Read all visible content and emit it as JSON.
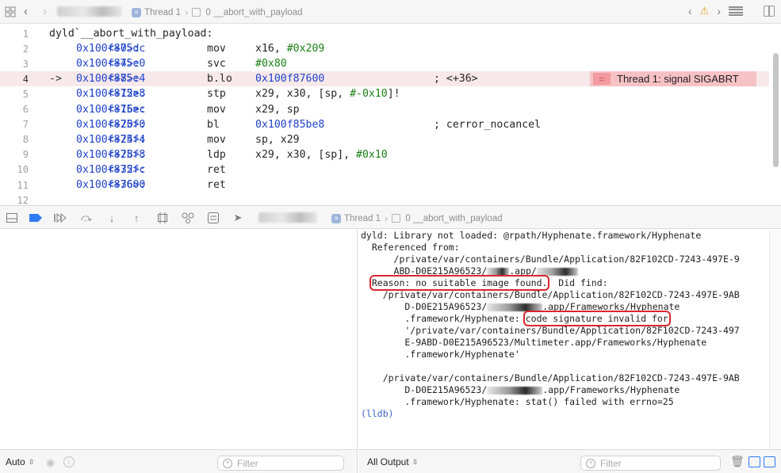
{
  "jump_bar": {
    "thread_label": "Thread 1",
    "frame_label": "0 __abort_with_payload",
    "icons": [
      "grid-icon",
      "back-icon",
      "forward-icon",
      "warning-icon",
      "related-items-icon",
      "split-editor-icon"
    ]
  },
  "editor": {
    "lines": [
      {
        "n": "1",
        "text": "dyld`__abort_with_payload:"
      },
      {
        "n": "2",
        "addr": "0x100f875dc",
        "off": "<+0>:",
        "op": "mov",
        "args": "x16, ",
        "num": "#0x209"
      },
      {
        "n": "3",
        "addr": "0x100f875e0",
        "off": "<+4>:",
        "op": "svc",
        "args": "",
        "num": "#0x80"
      },
      {
        "n": "4",
        "arrow": "->",
        "addr": "0x100f875e4",
        "off": "<+8>:",
        "op": "b.lo",
        "target": "0x100f87600",
        "comment": "; <+36>"
      },
      {
        "n": "5",
        "addr": "0x100f875e8",
        "off": "<+12>:",
        "op": "stp",
        "args": "x29, x30, [sp, ",
        "num": "#-0x10",
        "tail": "]!"
      },
      {
        "n": "6",
        "addr": "0x100f875ec",
        "off": "<+16>:",
        "op": "mov",
        "args": "x29, sp"
      },
      {
        "n": "7",
        "addr": "0x100f875f0",
        "off": "<+20>:",
        "op": "bl",
        "target": "0x100f85be8",
        "comment": "; cerror_nocancel"
      },
      {
        "n": "8",
        "addr": "0x100f875f4",
        "off": "<+24>:",
        "op": "mov",
        "args": "sp, x29"
      },
      {
        "n": "9",
        "addr": "0x100f875f8",
        "off": "<+28>:",
        "op": "ldp",
        "args": "x29, x30, [sp], ",
        "num": "#0x10"
      },
      {
        "n": "10",
        "addr": "0x100f875fc",
        "off": "<+32>:",
        "op": "ret"
      },
      {
        "n": "11",
        "addr": "0x100f87600",
        "off": "<+36>:",
        "op": "ret"
      },
      {
        "n": "12"
      }
    ],
    "error_badge": "Thread 1: signal SIGABRT",
    "error_badge_icon": "="
  },
  "debug_bar": {
    "thread_label": "Thread 1",
    "frame_label": "0 __abort_with_payload",
    "buttons": [
      "hide-debug-area-icon",
      "breakpoints-toggle-icon",
      "continue-icon",
      "step-over-icon",
      "step-into-icon",
      "step-out-icon",
      "view-hierarchy-icon",
      "memory-graph-icon",
      "environment-overrides-icon",
      "simulate-location-icon"
    ]
  },
  "console": {
    "lines": [
      {
        "t": "dyld: Library not loaded: @rpath/Hyphenate.framework/Hyphenate"
      },
      {
        "t": "  Referenced from:"
      },
      {
        "t": "      /private/var/containers/Bundle/Application/82F102CD-7243-497E-9"
      },
      {
        "t": "      ABD-D0E215A96523/",
        "blur": true,
        "after": ".app/",
        "blur2": true
      },
      {
        "pre": "  ",
        "boxed": "Reason: no suitable image found.",
        "post": "  Did find:"
      },
      {
        "t": "    /private/var/containers/Bundle/Application/82F102CD-7243-497E-9AB"
      },
      {
        "t": "        D-D0E215A96523/",
        "blur": true,
        "after": ".app/Frameworks/Hyphenate"
      },
      {
        "pre": "        .framework/Hyphenate: ",
        "boxed": "code signature invalid for"
      },
      {
        "t": "        '/private/var/containers/Bundle/Application/82F102CD-7243-497"
      },
      {
        "t": "        E-9ABD-D0E215A96523/Multimeter.app/Frameworks/Hyphenate"
      },
      {
        "t": "        .framework/Hyphenate'"
      },
      {
        "t": ""
      },
      {
        "t": "    /private/var/containers/Bundle/Application/82F102CD-7243-497E-9AB"
      },
      {
        "t": "        D-D0E215A96523/",
        "blur": true,
        "after": ".app/Frameworks/Hyphenate"
      },
      {
        "t": "        .framework/Hyphenate: stat() failed with errno=25"
      },
      {
        "t": "(lldb)",
        "lldb": true
      }
    ]
  },
  "bottom_left": {
    "scope_popup": "Auto",
    "filter_placeholder": "Filter"
  },
  "bottom_right": {
    "output_popup": "All Output",
    "filter_placeholder": "Filter"
  },
  "colors": {
    "accent": "#2f7bf6",
    "error_highlight": "#f6c2c5",
    "current_line": "#f7e9ea",
    "address": "#1f42c9",
    "immediate": "#1a7f16",
    "callout_box": "#d9262e"
  }
}
